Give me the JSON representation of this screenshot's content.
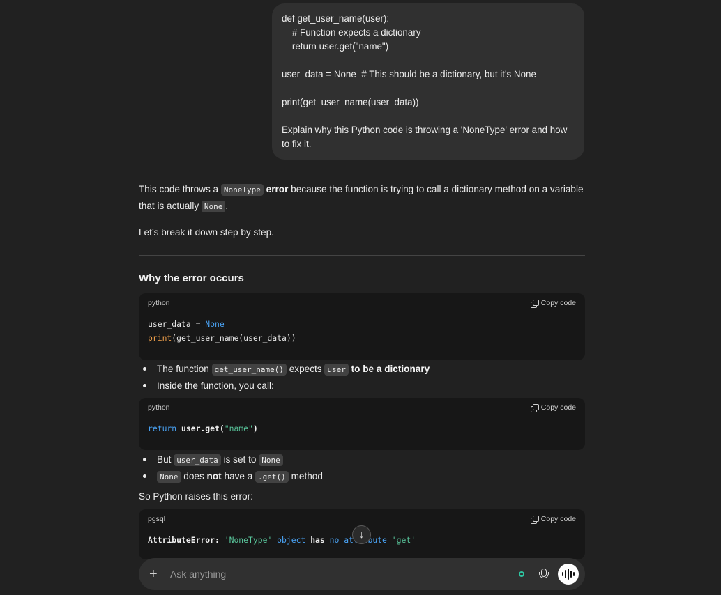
{
  "user_message": {
    "lines": [
      "def get_user_name(user):",
      "    # Function expects a dictionary",
      "    return user.get(\"name\")",
      "",
      "user_data = None  # This should be a dictionary, but it's None",
      "",
      "print(get_user_name(user_data))",
      "",
      "Explain why this Python code is throwing a 'NoneType' error and how to fix it."
    ]
  },
  "assistant": {
    "intro_p1_a": "This code throws a ",
    "intro_p1_code": "NoneType",
    "intro_p1_bold": " error",
    "intro_p1_b": " because the function is trying to call a dictionary method on a variable that is actually ",
    "intro_p1_code2": "None",
    "intro_p1_c": ".",
    "intro_p2": "Let’s break it down step by step.",
    "heading": "Why the error occurs",
    "code1": {
      "lang": "python",
      "copy_label": "Copy code",
      "line1_a": "user_data = ",
      "line1_b": "None",
      "line2_a": "print",
      "line2_b": "(get_user_name(user_data))"
    },
    "bullets1": {
      "b1_a": "The function ",
      "b1_code": "get_user_name()",
      "b1_b": " expects ",
      "b1_code2": "user",
      "b1_bold": " to be a dictionary",
      "b2": "Inside the function, you call:"
    },
    "code2": {
      "lang": "python",
      "copy_label": "Copy code",
      "kw": "return",
      "a": " user.get(",
      "str": "\"name\"",
      "b": ")"
    },
    "bullets2": {
      "b1_a": "But ",
      "b1_code": "user_data",
      "b1_b": " is set to ",
      "b1_code2": "None",
      "b2_code": "None",
      "b2_a": " does ",
      "b2_bold": "not",
      "b2_b": " have a ",
      "b2_code2": ".get()",
      "b2_c": " method"
    },
    "so_python": "So Python raises this error:",
    "code3": {
      "lang": "pgsql",
      "copy_label": "Copy code",
      "a": "AttributeError: ",
      "s1": "'NoneType'",
      "k1": " object ",
      "bold": "has",
      "k2": " no attribute ",
      "s2": "'get'"
    }
  },
  "scroll_button": {
    "icon": "arrow-down-icon",
    "glyph": "↓"
  },
  "composer": {
    "placeholder": "Ask anything",
    "plus_glyph": "+",
    "status_color": "#2ec4a0"
  }
}
